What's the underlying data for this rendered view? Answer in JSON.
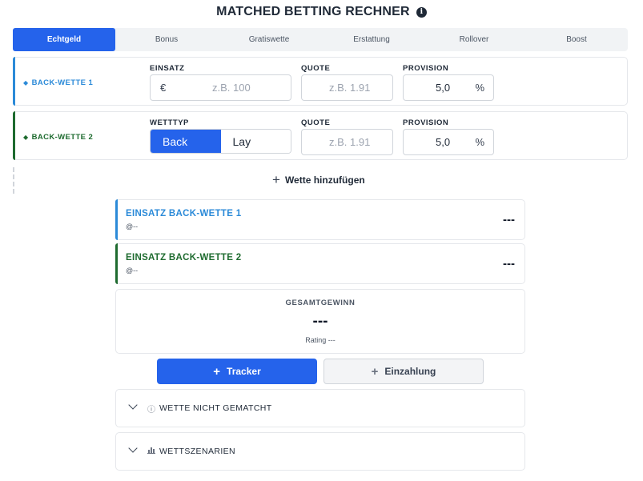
{
  "header": {
    "title": "MATCHED BETTING RECHNER",
    "info_icon": "i"
  },
  "tabs": [
    {
      "label": "Echtgeld",
      "active": true
    },
    {
      "label": "Bonus",
      "active": false
    },
    {
      "label": "Gratiswette",
      "active": false
    },
    {
      "label": "Erstattung",
      "active": false
    },
    {
      "label": "Rollover",
      "active": false
    },
    {
      "label": "Boost",
      "active": false
    }
  ],
  "bet1": {
    "label": "BACK-WETTE 1",
    "marker": "◆",
    "accent_color": "#2b8ad8",
    "stake_label": "EINSATZ",
    "currency": "€",
    "stake_placeholder": "z.B. 100",
    "odds_label": "QUOTE",
    "odds_placeholder": "z.B. 1.91",
    "commission_label": "PROVISION",
    "commission_value": "5,0",
    "commission_unit": "%"
  },
  "bet2": {
    "label": "BACK-WETTE 2",
    "marker": "◆",
    "accent_color": "#1e6b2f",
    "type_label": "WETTTYP",
    "type_options": [
      "Back",
      "Lay"
    ],
    "type_selected": "Back",
    "odds_label": "QUOTE",
    "odds_placeholder": "z.B. 1.91",
    "commission_label": "PROVISION",
    "commission_value": "5,0",
    "commission_unit": "%"
  },
  "add_bet": {
    "icon": "+",
    "label": "Wette hinzufügen"
  },
  "results": [
    {
      "title": "EINSATZ BACK-WETTE 1",
      "sub": "@--",
      "value": "---",
      "color": "#2b8ad8"
    },
    {
      "title": "EINSATZ BACK-WETTE 2",
      "sub": "@--",
      "value": "---",
      "color": "#1e6b2f"
    }
  ],
  "total": {
    "label": "GESAMTGEWINN",
    "value": "---",
    "rating": "Rating ---"
  },
  "buttons": {
    "tracker": {
      "icon": "+",
      "label": "Tracker"
    },
    "deposit": {
      "icon": "+",
      "label": "Einzahlung"
    }
  },
  "accordions": [
    {
      "icon": "ⓘ",
      "icon_name": "info-circle-icon",
      "title": "WETTE NICHT GEMATCHT"
    },
    {
      "icon": "📊",
      "icon_name": "bar-chart-icon",
      "title": "WETTSZENARIEN"
    }
  ],
  "colors": {
    "primary": "#2563eb",
    "bet1": "#2b8ad8",
    "bet2": "#1e6b2f"
  }
}
